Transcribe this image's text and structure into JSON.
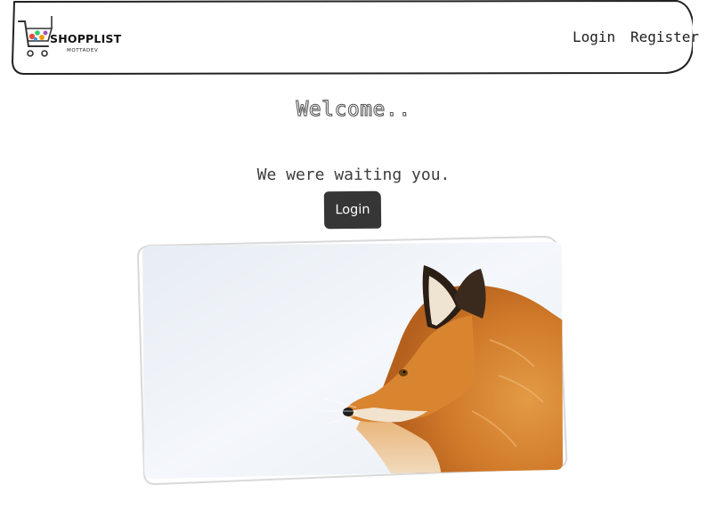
{
  "navbar": {
    "brand": {
      "name": "SHOPPLIST",
      "subtitle": "MOTTADEV"
    },
    "links": {
      "login": "Login",
      "register": "Register"
    }
  },
  "hero": {
    "welcome": "Welcome..",
    "tagline": "We were waiting you.",
    "login_button": "Login"
  },
  "photo": {
    "icon": "fox-photo"
  },
  "colors": {
    "button_bg": "#363636",
    "button_text": "#ffffff",
    "navbar_border": "#222222",
    "card_border": "#d9d9d9",
    "fox_orange": "#d9822b",
    "background": "#ffffff"
  }
}
